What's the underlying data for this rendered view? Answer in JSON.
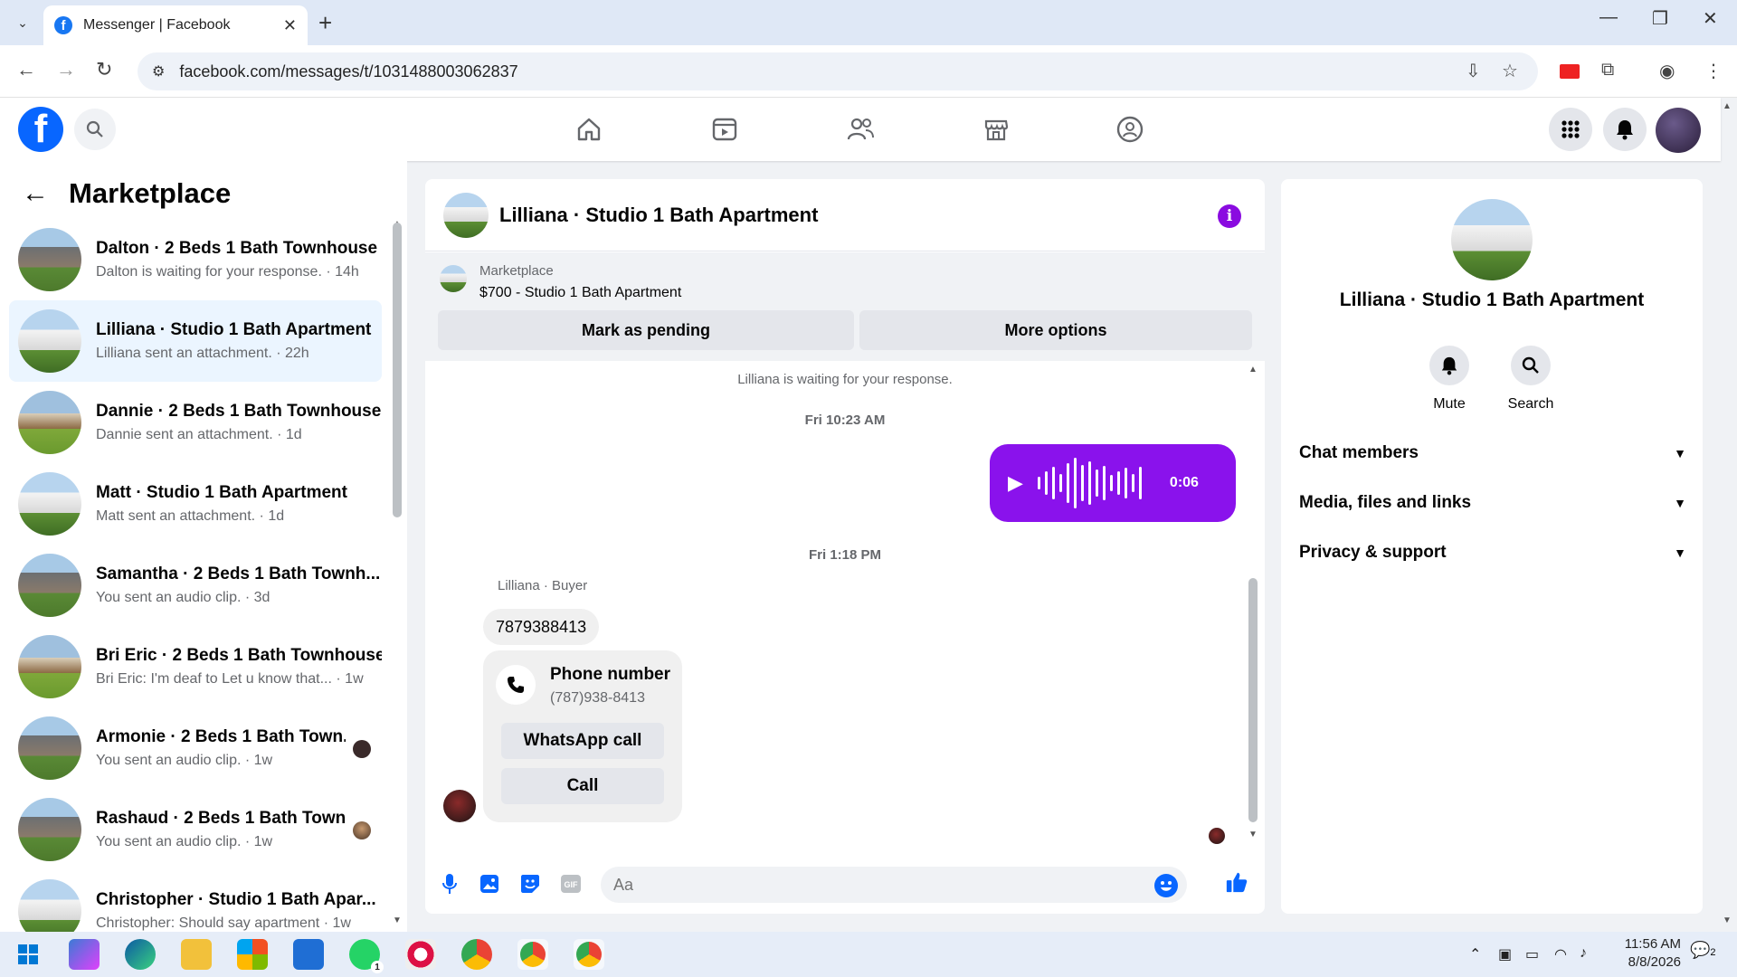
{
  "browser": {
    "tab_title": "Messenger | Facebook",
    "url": "facebook.com/messages/t/1031488003062837",
    "favicon_letter": "f"
  },
  "fb": {
    "logo_letter": "f"
  },
  "left": {
    "title": "Marketplace",
    "chats": [
      {
        "name": "Dalton · 2 Beds 1 Bath Townhouse",
        "sub": "Dalton is waiting for your response. · 14h",
        "thumb": "brown-house",
        "active": false
      },
      {
        "name": "Lilliana · Studio 1 Bath Apartment",
        "sub": "Lilliana sent an attachment. · 22h",
        "thumb": "white-house",
        "active": true
      },
      {
        "name": "Dannie · 2 Beds 1 Bath Townhouse",
        "sub": "Dannie sent an attachment. · 1d",
        "thumb": "tan-house",
        "active": false
      },
      {
        "name": "Matt · Studio 1 Bath Apartment",
        "sub": "Matt sent an attachment. · 1d",
        "thumb": "white-house",
        "active": false
      },
      {
        "name": "Samantha · 2 Beds 1 Bath Townh...",
        "sub": "You sent an audio clip. · 3d",
        "thumb": "brown-house",
        "active": false
      },
      {
        "name": "Bri Eric · 2 Beds 1 Bath Townhouse",
        "sub": "Bri Eric: I'm deaf to Let u know that... · 1w",
        "thumb": "tan-house",
        "active": false
      },
      {
        "name": "Armonie · 2 Beds 1 Bath Town...",
        "sub": "You sent an audio clip. · 1w",
        "thumb": "brown-house",
        "active": false
      },
      {
        "name": "Rashaud · 2 Beds 1 Bath Town...",
        "sub": "You sent an audio clip. · 1w",
        "thumb": "brown-house",
        "active": false
      },
      {
        "name": "Christopher · Studio 1 Bath Apar...",
        "sub": "Christopher: Should say apartment · 1w",
        "thumb": "white-house",
        "active": false
      }
    ]
  },
  "conversation": {
    "title": "Lilliana · Studio 1 Bath Apartment",
    "marketplace_label": "Marketplace",
    "listing": "$700 - Studio 1 Bath Apartment",
    "mark_pending": "Mark as pending",
    "more_options": "More options",
    "waiting_note": "Lilliana is waiting for your response.",
    "time1": "Fri 10:23 AM",
    "audio_duration": "0:06",
    "time2": "Fri 1:18 PM",
    "sender_label": "Lilliana · Buyer",
    "message_text": "7879388413",
    "phone_card_title": "Phone number",
    "phone_card_number": "(787)938-8413",
    "whatsapp_call": "WhatsApp call",
    "call": "Call",
    "composer_placeholder": "Aa"
  },
  "info": {
    "name": "Lilliana · Studio 1 Bath Apartment",
    "mute": "Mute",
    "search": "Search",
    "sections": [
      "Chat members",
      "Media, files and links",
      "Privacy & support"
    ]
  },
  "taskbar": {
    "time": "11:56 AM",
    "date": "8/8/2026",
    "whatsapp_badge": "1",
    "notif_count": "2"
  },
  "colors": {
    "fb_blue": "#0866ff",
    "messenger_purple": "#8a12ec",
    "active_chat_bg": "#ebf5ff"
  }
}
